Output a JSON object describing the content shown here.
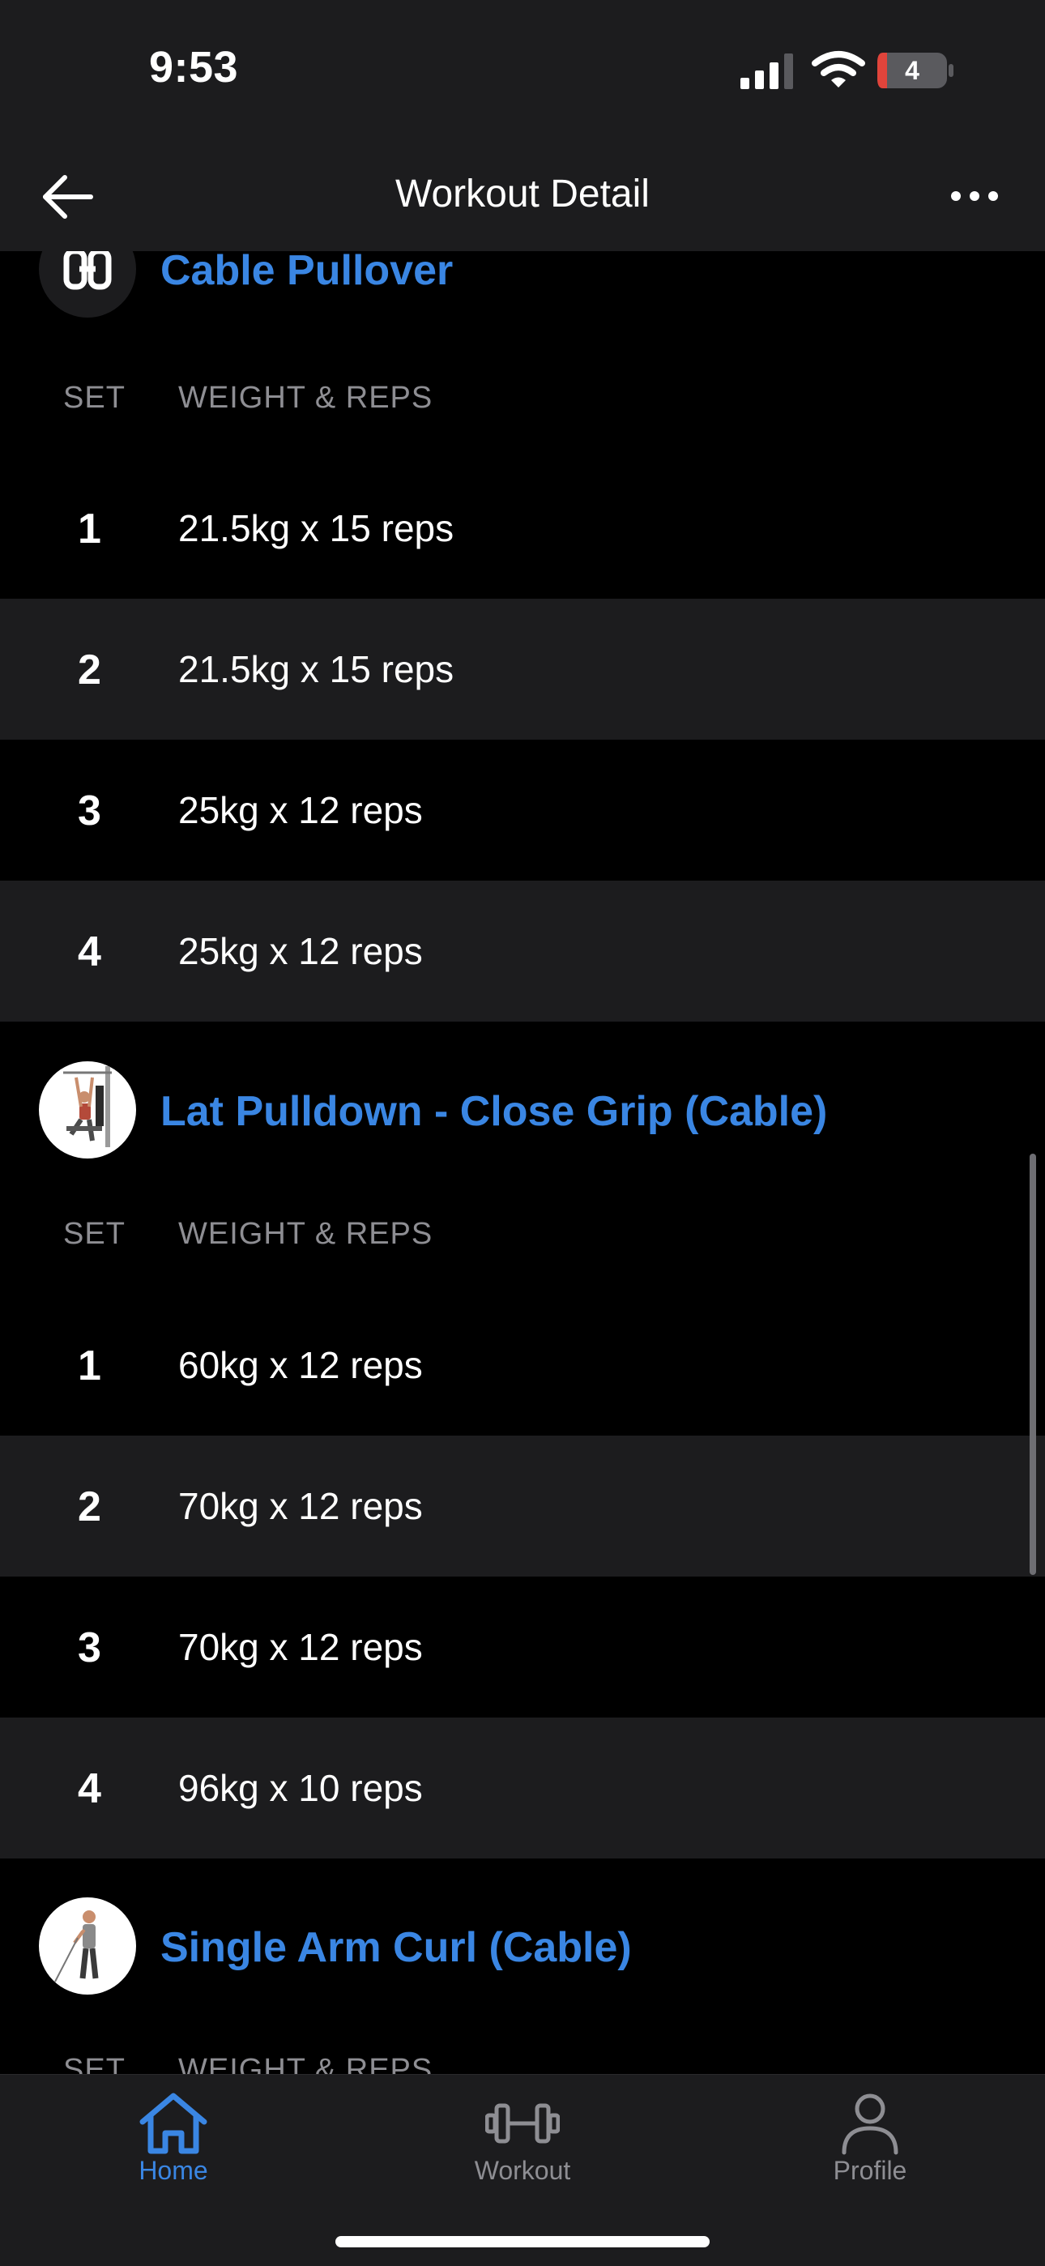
{
  "status_bar": {
    "time": "9:53",
    "battery": "4"
  },
  "nav": {
    "title": "Workout Detail",
    "back_icon": "arrow-left-icon",
    "more_icon": "ellipsis-icon"
  },
  "columns": {
    "set": "SET",
    "weight_reps": "WEIGHT & REPS"
  },
  "exercises": [
    {
      "name": "Cable Pullover",
      "icon": "hevy-logo-icon",
      "sets": [
        {
          "num": "1",
          "value": "21.5kg x 15 reps"
        },
        {
          "num": "2",
          "value": "21.5kg x 15 reps"
        },
        {
          "num": "3",
          "value": "25kg x 12 reps"
        },
        {
          "num": "4",
          "value": "25kg x 12 reps"
        }
      ]
    },
    {
      "name": "Lat Pulldown - Close Grip (Cable)",
      "icon": "lat-pulldown-figure-icon",
      "sets": [
        {
          "num": "1",
          "value": "60kg x 12 reps"
        },
        {
          "num": "2",
          "value": "70kg x 12 reps"
        },
        {
          "num": "3",
          "value": "70kg x 12 reps"
        },
        {
          "num": "4",
          "value": "96kg x 10 reps"
        }
      ]
    },
    {
      "name": "Single Arm Curl (Cable)",
      "icon": "single-arm-curl-figure-icon",
      "sets": []
    }
  ],
  "tabs": [
    {
      "label": "Home",
      "icon": "home-icon",
      "active": true
    },
    {
      "label": "Workout",
      "icon": "dumbbell-icon",
      "active": false
    },
    {
      "label": "Profile",
      "icon": "person-icon",
      "active": false
    }
  ],
  "colors": {
    "accent": "#3a86e3",
    "background": "#000000",
    "surface": "#1c1c1e",
    "muted": "#8e8e93"
  }
}
